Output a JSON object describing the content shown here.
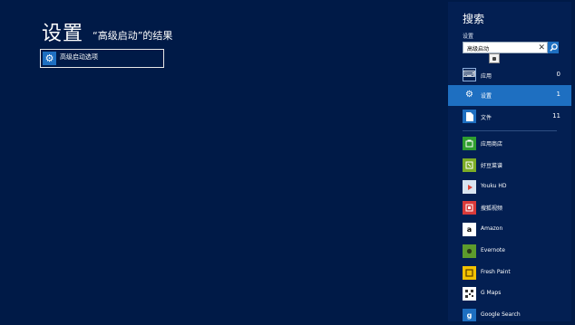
{
  "main": {
    "title": "设置",
    "results_heading": "“高级启动”的结果",
    "results": [
      {
        "label": "高级启动选项",
        "icon": "gear-icon"
      }
    ]
  },
  "search_pane": {
    "title": "搜索",
    "scope_label": "设置",
    "search": {
      "value": "高级启动",
      "clear_icon": "close-icon",
      "search_icon": "magnifier-icon"
    },
    "scopes": [
      {
        "name": "应用",
        "count": "0",
        "icon": "keyboard-icon"
      },
      {
        "name": "设置",
        "count": "1",
        "icon": "gear-icon",
        "selected": true
      },
      {
        "name": "文件",
        "count": "11",
        "icon": "document-icon"
      }
    ],
    "apps": [
      {
        "name": "应用商店",
        "icon": "store-icon",
        "color": "#2f9e2f"
      },
      {
        "name": "好豆菜谱",
        "icon": "recipe-icon",
        "color": "#7cac26"
      },
      {
        "name": "Youku HD",
        "icon": "youku-icon",
        "color": "#d9e5f1"
      },
      {
        "name": "搜狐视频",
        "icon": "sohu-video-icon",
        "color": "#d93a3a"
      },
      {
        "name": "Amazon",
        "icon": "amazon-icon",
        "color": "#ffffff"
      },
      {
        "name": "Evernote",
        "icon": "evernote-icon",
        "color": "#5d9c2c"
      },
      {
        "name": "Fresh Paint",
        "icon": "fresh-paint-icon",
        "color": "#f2c200"
      },
      {
        "name": "G Maps",
        "icon": "gmaps-icon",
        "color": "#ffffff"
      },
      {
        "name": "Google Search",
        "icon": "google-search-icon",
        "color": "#1e6fc1"
      }
    ]
  }
}
